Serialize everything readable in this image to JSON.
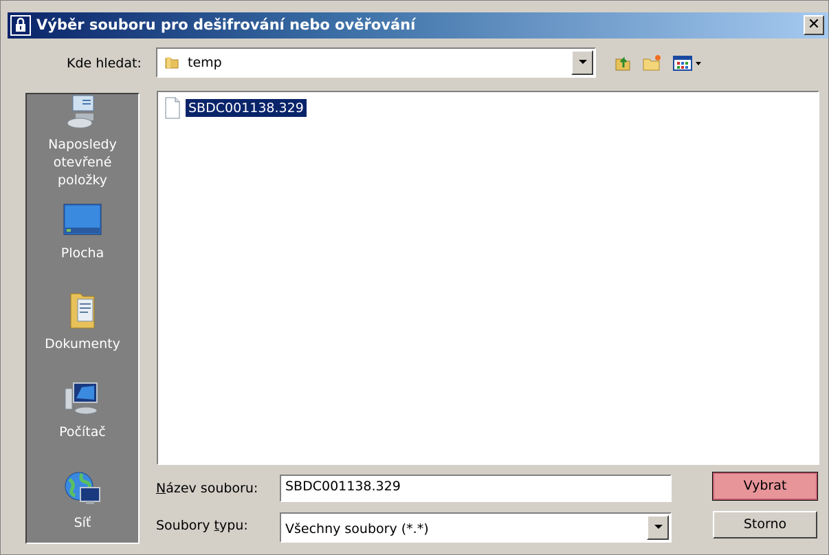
{
  "window": {
    "title": "Výběr souboru pro dešifrování nebo ověřování",
    "close_glyph": "✕"
  },
  "lookin": {
    "label": "Kde hledat:",
    "value": "temp"
  },
  "places": [
    {
      "id": "recent",
      "label": "Naposledy otevřené položky",
      "icon": "recent-items-icon"
    },
    {
      "id": "desktop",
      "label": "Plocha",
      "icon": "desktop-icon"
    },
    {
      "id": "documents",
      "label": "Dokumenty",
      "icon": "documents-icon"
    },
    {
      "id": "computer",
      "label": "Počítač",
      "icon": "computer-icon"
    },
    {
      "id": "network",
      "label": "Síť",
      "icon": "network-icon"
    }
  ],
  "files": [
    {
      "name": "SBDC001138.329",
      "selected": true
    }
  ],
  "filename": {
    "label_accel": "N",
    "label_rest": "ázev souboru:",
    "value": "SBDC001138.329"
  },
  "filetype": {
    "label_pre": "Soubory ",
    "label_accel": "t",
    "label_rest": "ypu:",
    "value": "Všechny soubory (*.*)"
  },
  "buttons": {
    "select": "Vybrat",
    "cancel": "Storno"
  },
  "colors": {
    "titlebar_start": "#0a246a",
    "titlebar_end": "#a6caf0",
    "selection": "#0a246a",
    "default_button": "#e8959a",
    "dialog_bg": "#d4d0c8"
  }
}
